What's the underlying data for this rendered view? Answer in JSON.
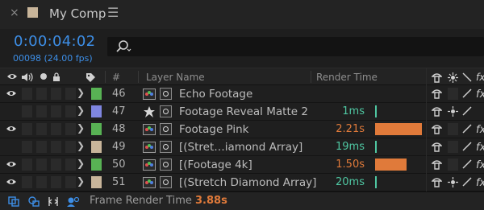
{
  "tab": {
    "close_glyph": "×",
    "title": "My Comp",
    "menu_glyph": "☰",
    "swatch_color": "#c8b59a"
  },
  "time": {
    "timecode": "0:00:04:02",
    "frames": "00098 (24.00 fps)"
  },
  "search": {
    "icon": "search-icon",
    "value": ""
  },
  "header": {
    "hash": "#",
    "layer_name": "Layer Name",
    "render_time": "Render Time",
    "fx": "fx"
  },
  "colors": {
    "accent": "#3d8ee6",
    "bar": "#e07a3a",
    "fast": "#4fc7a2",
    "slow": "#e07a3a"
  },
  "layers": [
    {
      "visible": true,
      "expanded": false,
      "label_color": "#58b254",
      "number": "46",
      "name": "Echo Footage",
      "source": "footage",
      "render_time": "",
      "time_color": "",
      "bar_fraction": 0,
      "has_fx": true,
      "motion_blur_icon": false
    },
    {
      "visible": false,
      "expanded": false,
      "label_color": "#7f86e0",
      "number": "47",
      "name": "Footage Reveal Matte 2",
      "source": "star",
      "render_time": "1ms",
      "time_color": "#4fc7a2",
      "bar_fraction": 0,
      "has_fx": false,
      "motion_blur_icon": true
    },
    {
      "visible": true,
      "expanded": false,
      "label_color": "#58b254",
      "number": "48",
      "name": "Footage Pink",
      "source": "footage",
      "render_time": "2.21s",
      "time_color": "#e07a3a",
      "bar_fraction": 1.0,
      "has_fx": true,
      "motion_blur_icon": false
    },
    {
      "visible": false,
      "expanded": false,
      "label_color": "#c8b59a",
      "number": "49",
      "name": "[(Stret…iamond Array]",
      "source": "footage",
      "render_time": "19ms",
      "time_color": "#4fc7a2",
      "bar_fraction": 0,
      "has_fx": true,
      "motion_blur_icon": false
    },
    {
      "visible": true,
      "expanded": false,
      "label_color": "#58b254",
      "number": "50",
      "name": "[(Footage 4k]",
      "source": "footage",
      "render_time": "1.50s",
      "time_color": "#e07a3a",
      "bar_fraction": 0.68,
      "has_fx": true,
      "motion_blur_icon": false
    },
    {
      "visible": true,
      "expanded": false,
      "label_color": "#c8b59a",
      "number": "51",
      "name": "[(Stretch Diamond Array]",
      "source": "footage",
      "render_time": "20ms",
      "time_color": "#4fc7a2",
      "bar_fraction": 0,
      "has_fx": true,
      "motion_blur_icon": true
    }
  ],
  "footer": {
    "label": "Frame Render Time",
    "value": "3.88s"
  }
}
